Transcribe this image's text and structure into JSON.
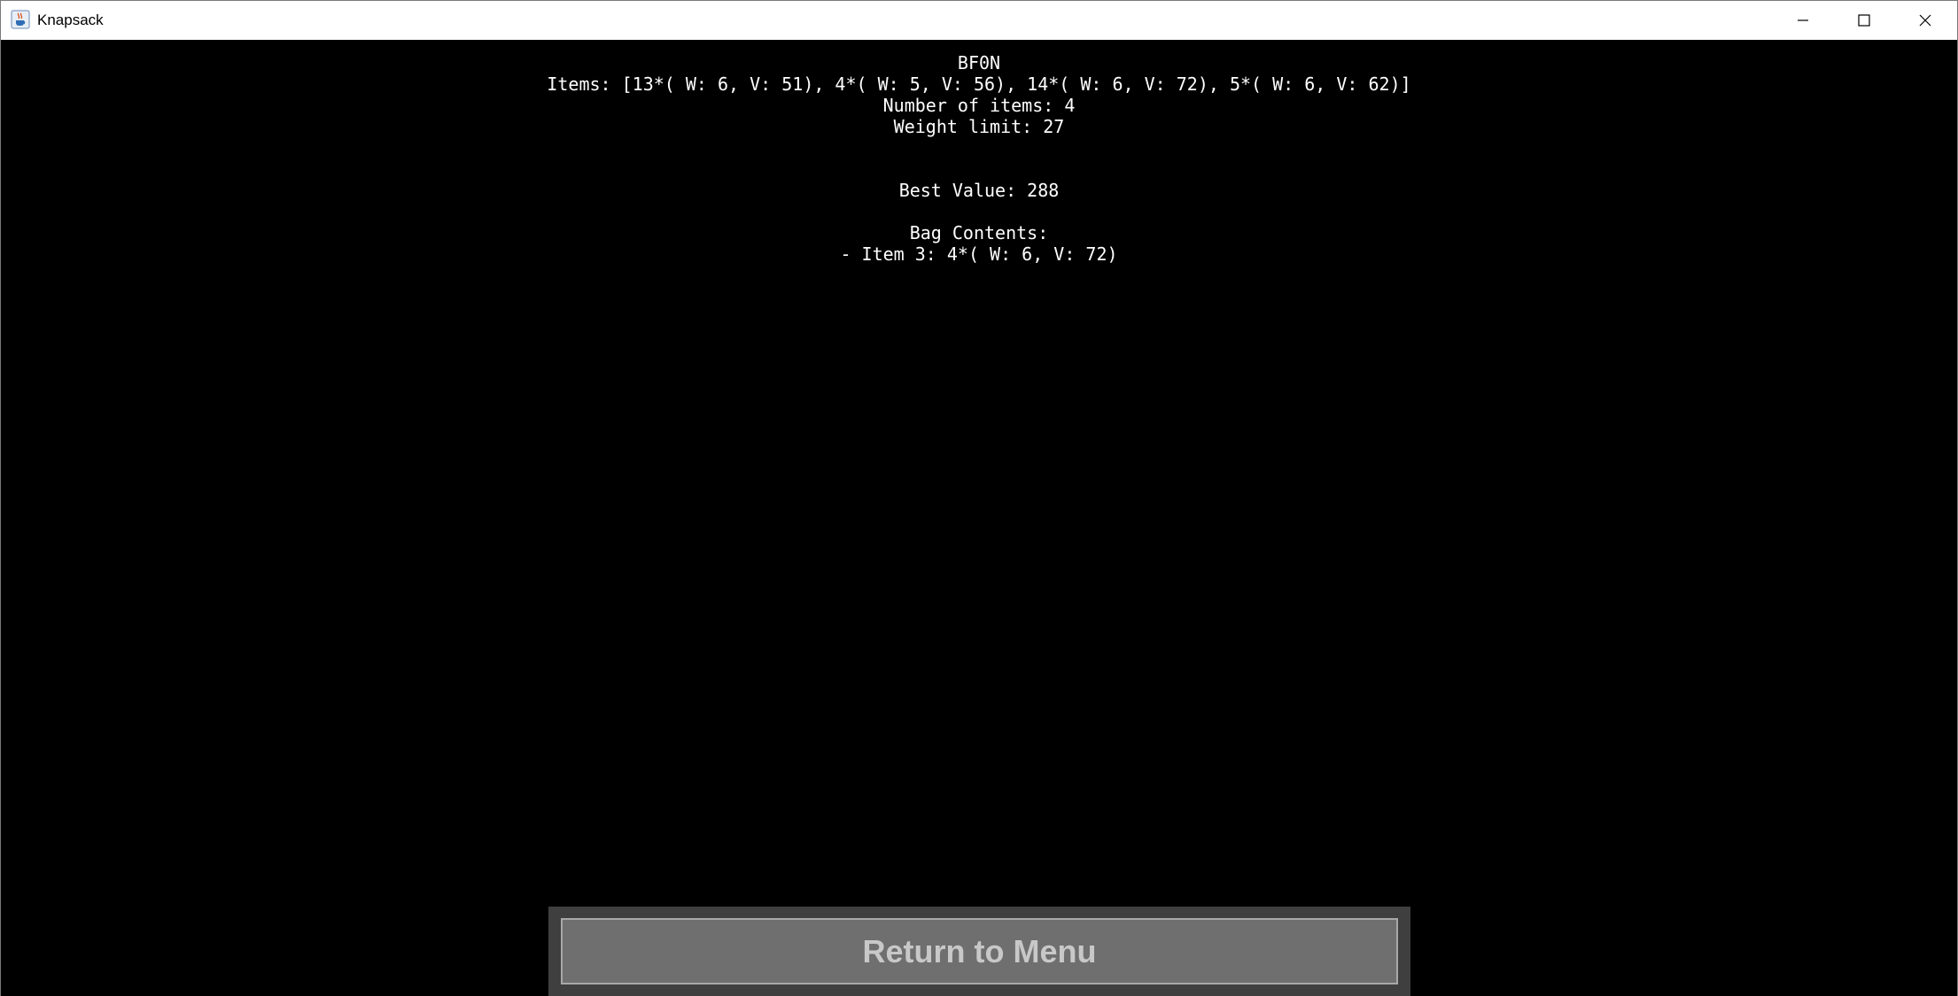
{
  "window": {
    "title": "Knapsack",
    "icon": "java-cup-icon",
    "controls": {
      "minimize_icon": "minimize-icon",
      "maximize_icon": "maximize-icon",
      "close_icon": "close-icon"
    }
  },
  "result": {
    "algorithm": "BF0N",
    "items_line": "Items: [13*( W: 6, V: 51), 4*( W: 5, V: 56), 14*( W: 6, V: 72), 5*( W: 6, V: 62)]",
    "number_of_items": "Number of items: 4",
    "weight_limit": "Weight limit: 27",
    "best_value": "Best Value: 288",
    "bag_contents_heading": "Bag Contents:",
    "bag_contents": [
      "- Item 3: 4*( W: 6, V: 72)"
    ]
  },
  "footer": {
    "return_button_label": "Return to Menu"
  },
  "colors": {
    "background": "#000000",
    "text": "#ffffff",
    "button_bg": "#6f6f6f",
    "button_text": "#c8c8c8",
    "panel_bg": "#3f3f3f"
  }
}
